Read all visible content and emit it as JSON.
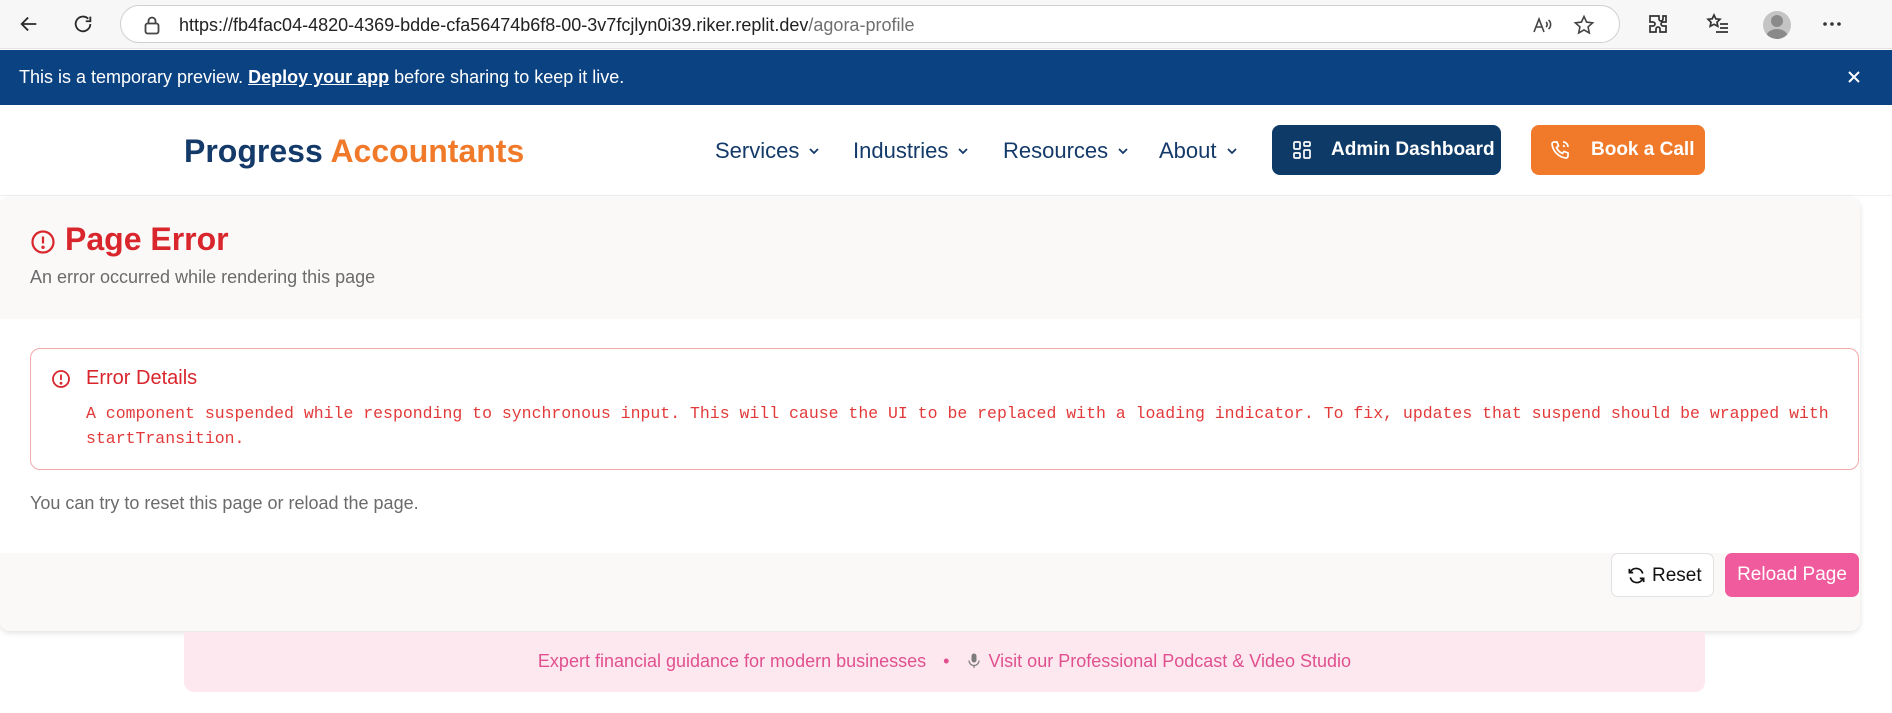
{
  "browser": {
    "url_host": "https://fb4fac04-4820-4369-bdde-cfa56474b6f8-00-3v7fcjlyn0i39.riker.replit.dev",
    "url_path": "/agora-profile"
  },
  "preview_banner": {
    "text_before": "This is a temporary preview. ",
    "link_text": "Deploy your app",
    "text_after": " before sharing to keep it live."
  },
  "header": {
    "brand_part1": "Progress",
    "brand_part2": "Accountants",
    "nav": [
      {
        "label": "Services"
      },
      {
        "label": "Industries"
      },
      {
        "label": "Resources"
      },
      {
        "label": "About"
      }
    ],
    "admin_button": "Admin Dashboard",
    "call_button": "Book a Call"
  },
  "error": {
    "title": "Page Error",
    "subtitle": "An error occurred while rendering this page",
    "details_title": "Error Details",
    "details_message": "A component suspended while responding to synchronous input. This will cause the UI to be replaced with a loading indicator. To fix, updates that suspend should be wrapped with startTransition.",
    "help_text": "You can try to reset this page or reload the page.",
    "reset_button": "Reset",
    "reload_button": "Reload Page"
  },
  "promo": {
    "text1": "Expert financial guidance for modern businesses",
    "separator": "•",
    "text2": "Visit our Professional Podcast & Video Studio"
  },
  "colors": {
    "navy": "#143a6a",
    "orange": "#f07a2a",
    "error_red": "#d9262d",
    "pink": "#ef5b9c",
    "banner_blue": "#0b4282"
  }
}
